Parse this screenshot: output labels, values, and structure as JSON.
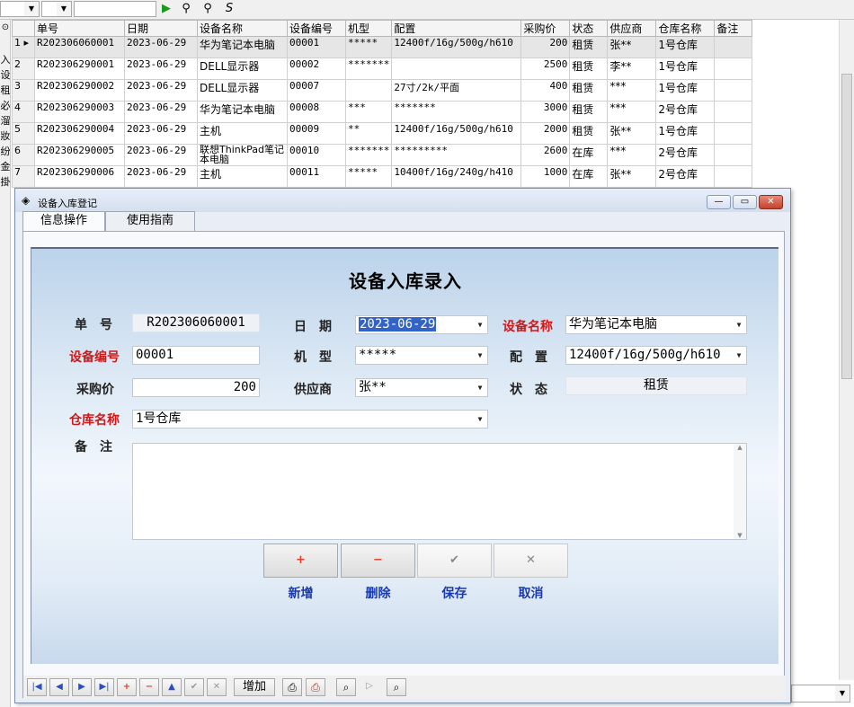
{
  "grid": {
    "headers": [
      "",
      "单号",
      "日期",
      "设备名称",
      "设备编号",
      "机型",
      "配置",
      "采购价",
      "状态",
      "供应商",
      "仓库名称",
      "备注"
    ],
    "rows": [
      {
        "idx": "1 ▸",
        "id": "R202306060001",
        "date": "2023-06-29",
        "name": "华为笔记本电脑",
        "code": "00001",
        "model": "*****",
        "config": "12400f/16g/500g/h610",
        "price": "200",
        "status": "租赁",
        "supplier": "张**",
        "warehouse": "1号仓库",
        "note": ""
      },
      {
        "idx": "2",
        "id": "R202306290001",
        "date": "2023-06-29",
        "name": "DELL显示器",
        "code": "00002",
        "model": "*******",
        "config": "",
        "price": "2500",
        "status": "租赁",
        "supplier": "李**",
        "warehouse": "1号仓库",
        "note": ""
      },
      {
        "idx": "3",
        "id": "R202306290002",
        "date": "2023-06-29",
        "name": "DELL显示器",
        "code": "00007",
        "model": "",
        "config": "27寸/2k/平面",
        "price": "400",
        "status": "租赁",
        "supplier": "***",
        "warehouse": "1号仓库",
        "note": ""
      },
      {
        "idx": "4",
        "id": "R202306290003",
        "date": "2023-06-29",
        "name": "华为笔记本电脑",
        "code": "00008",
        "model": "***",
        "config": "*******",
        "price": "3000",
        "status": "租赁",
        "supplier": "***",
        "warehouse": "2号仓库",
        "note": ""
      },
      {
        "idx": "5",
        "id": "R202306290004",
        "date": "2023-06-29",
        "name": "主机",
        "code": "00009",
        "model": "**",
        "config": "12400f/16g/500g/h610",
        "price": "2000",
        "status": "租赁",
        "supplier": "张**",
        "warehouse": "1号仓库",
        "note": ""
      },
      {
        "idx": "6",
        "id": "R202306290005",
        "date": "2023-06-29",
        "name": "联想ThinkPad笔记本电脑",
        "code": "00010",
        "model": "*******",
        "config": "*********",
        "price": "2600",
        "status": "在库",
        "supplier": "***",
        "warehouse": "2号仓库",
        "note": ""
      },
      {
        "idx": "7",
        "id": "R202306290006",
        "date": "2023-06-29",
        "name": "主机",
        "code": "00011",
        "model": "*****",
        "config": "10400f/16g/240g/h410",
        "price": "1000",
        "status": "在库",
        "supplier": "张**",
        "warehouse": "2号仓库",
        "note": ""
      }
    ]
  },
  "left_strip_chars": [
    "入",
    "设",
    "租",
    "必",
    "溜",
    "妝",
    "纷",
    "金",
    "掛"
  ],
  "dialog": {
    "title": "设备入库登记",
    "tabs": [
      "信息操作",
      "使用指南"
    ],
    "form_title": "设备入库录入",
    "labels": {
      "id": "单　号",
      "date": "日　期",
      "name": "设备名称",
      "code": "设备编号",
      "model": "机　型",
      "config": "配　置",
      "price": "采购价",
      "supplier": "供应商",
      "status": "状　态",
      "warehouse": "仓库名称",
      "note": "备　注"
    },
    "values": {
      "id": "R202306060001",
      "date": "2023-06-29",
      "name": "华为笔记本电脑",
      "code": "00001",
      "model": "*****",
      "config": "12400f/16g/500g/h610",
      "price": "200",
      "supplier": "张**",
      "status": "租赁",
      "warehouse": "1号仓库",
      "note": ""
    },
    "buttons": {
      "add": "新增",
      "delete": "删除",
      "save": "保存",
      "cancel": "取消"
    },
    "navbar": {
      "add_label": "增加"
    }
  }
}
